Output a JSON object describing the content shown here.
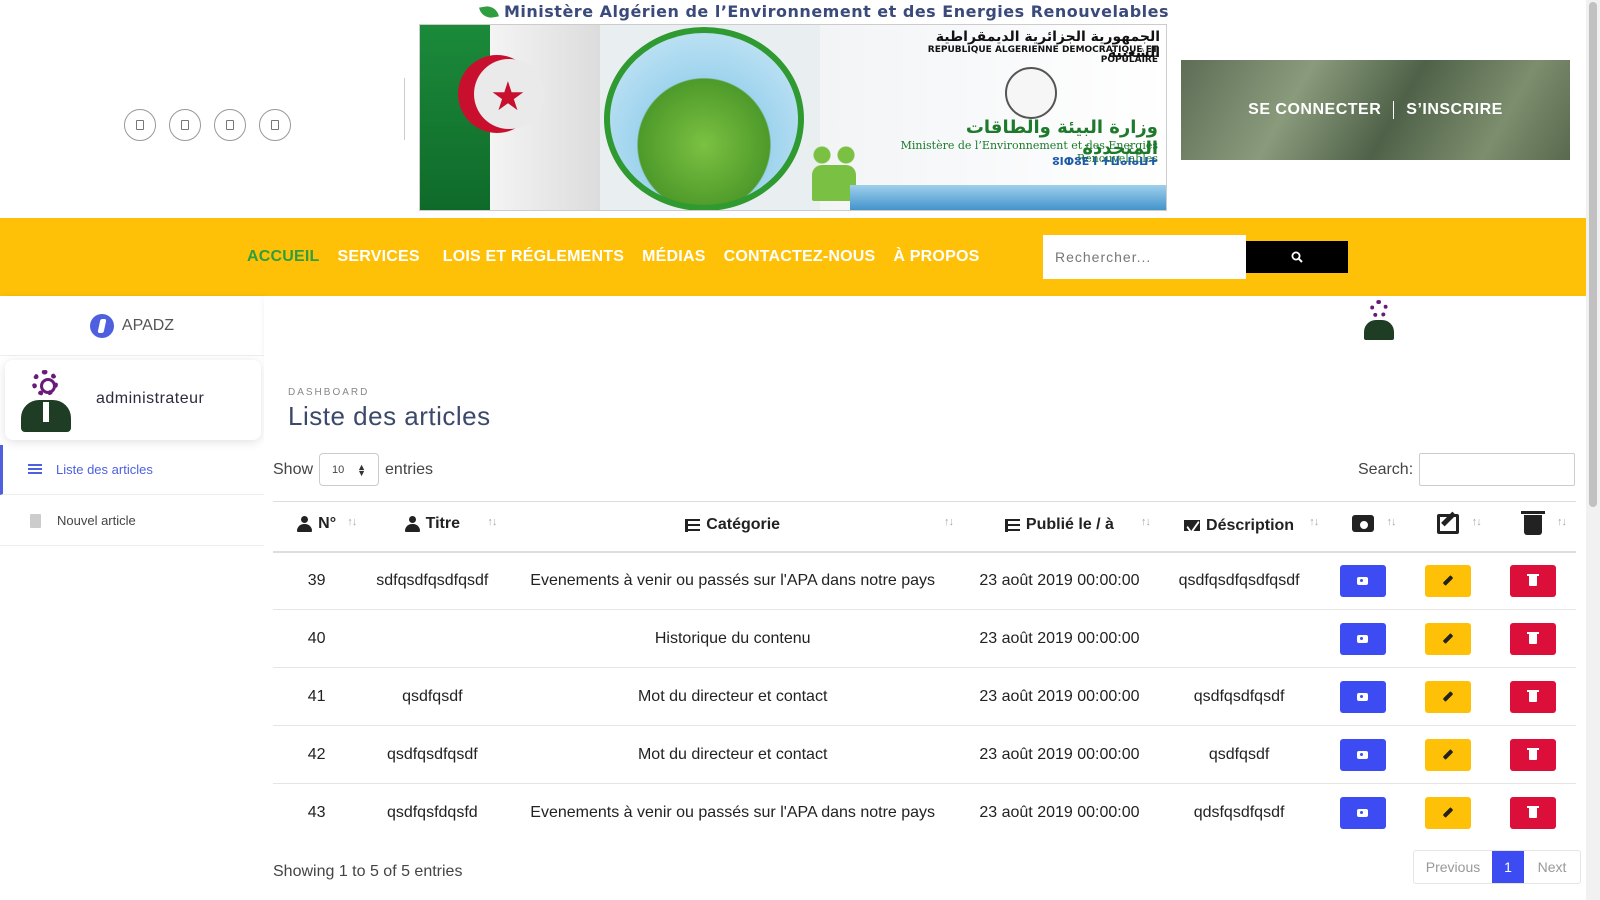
{
  "header": {
    "ministry_title": "Ministère Algérien de l’Environnement et des Energies Renouvelables",
    "social_icons": [
      "social-icon-1",
      "social-icon-2",
      "social-icon-3",
      "social-icon-4"
    ],
    "banner": {
      "arabic_republic": "الجمهورية الجزائرية الديمقراطية الشعبية",
      "french_republic": "REPUBLIQUE ALGERIENNE DEMOCRATIQUE ET POPULAIRE",
      "arabic_ministry": "وزارة البيئة والطاقات المتجددة",
      "french_ministry": "Ministère de l’Environnement et des Energies Renouvelables",
      "tifinagh_ministry": "ⵓⵏⵀⵓⴹ ⵏ ⵜⵡⴰⵏⴰⵡⵜ"
    },
    "login": "SE CONNECTER",
    "register": "S’INSCRIRE"
  },
  "nav": {
    "items": [
      "ACCUEIL",
      "SERVICES",
      "LOIS ET RÉGLEMENTS",
      "MÉDIAS",
      "CONTACTEZ-NOUS",
      "À PROPOS"
    ],
    "search_placeholder": "Rechercher..."
  },
  "sidebar": {
    "brand": "APADZ",
    "user": "administrateur",
    "items": [
      {
        "label": "Liste des articles",
        "active": true
      },
      {
        "label": "Nouvel article",
        "active": false
      }
    ]
  },
  "page": {
    "breadcrumb": "DASHBOARD",
    "title": "Liste des articles"
  },
  "datatable": {
    "show_label": "Show",
    "entries_label": "entries",
    "page_length": "10",
    "search_label": "Search:",
    "columns": [
      "N°",
      "Titre",
      "Catégorie",
      "Publié le / à",
      "Déscription"
    ],
    "rows": [
      {
        "num": "39",
        "title": "sdfqsdfqsdfqsdf",
        "category": "Evenements à venir ou passés sur l'APA dans notre pays",
        "published": "23 août 2019 00:00:00",
        "description": "qsdfqsdfqsdfqsdf"
      },
      {
        "num": "40",
        "title": "",
        "category": "Historique du contenu",
        "published": "23 août 2019 00:00:00",
        "description": ""
      },
      {
        "num": "41",
        "title": "qsdfqsdf",
        "category": "Mot du directeur et contact",
        "published": "23 août 2019 00:00:00",
        "description": "qsdfqsdfqsdf"
      },
      {
        "num": "42",
        "title": "qsdfqsdfqsdf",
        "category": "Mot du directeur et contact",
        "published": "23 août 2019 00:00:00",
        "description": "qsdfqsdf"
      },
      {
        "num": "43",
        "title": "qsdfqsfdqsfd",
        "category": "Evenements à venir ou passés sur l'APA dans notre pays",
        "published": "23 août 2019 00:00:00",
        "description": "qdsfqsdfqsdf"
      }
    ],
    "info": "Showing 1 to 5 of 5 entries",
    "pagination": {
      "previous": "Previous",
      "current": "1",
      "next": "Next"
    }
  },
  "colors": {
    "nav_bg": "#ffc107",
    "nav_active": "#2e9e3e",
    "accent": "#3d4cf2",
    "edit": "#ffc107",
    "delete": "#dc0f3b"
  }
}
